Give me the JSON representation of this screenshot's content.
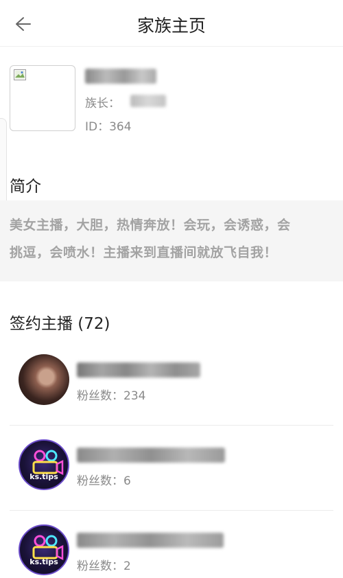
{
  "header": {
    "title": "家族主页",
    "back_icon": "arrow-left-icon"
  },
  "family": {
    "leader_label": "族长：",
    "id_label": "ID：",
    "id_value": "364"
  },
  "intro": {
    "heading": "简介",
    "line1": "美女主播，大胆，热情奔放！会玩，会诱惑，会",
    "line2": "挑逗，会喷水！主播来到直播间就放飞自我！"
  },
  "anchors": {
    "heading": "签约主播 (72)",
    "items": [
      {
        "fans_text": "粉丝数：234",
        "avatar": "photo"
      },
      {
        "fans_text": "粉丝数：6",
        "avatar": "ks-tips-logo",
        "logo_text": "ks.tips"
      },
      {
        "fans_text": "粉丝数：2",
        "avatar": "ks-tips-logo",
        "logo_text": "ks.tips"
      }
    ]
  },
  "colors": {
    "text_primary": "#222222",
    "text_secondary": "#8a8a8a",
    "intro_bg": "#f5f5f5",
    "intro_text": "#a3a3a3"
  }
}
